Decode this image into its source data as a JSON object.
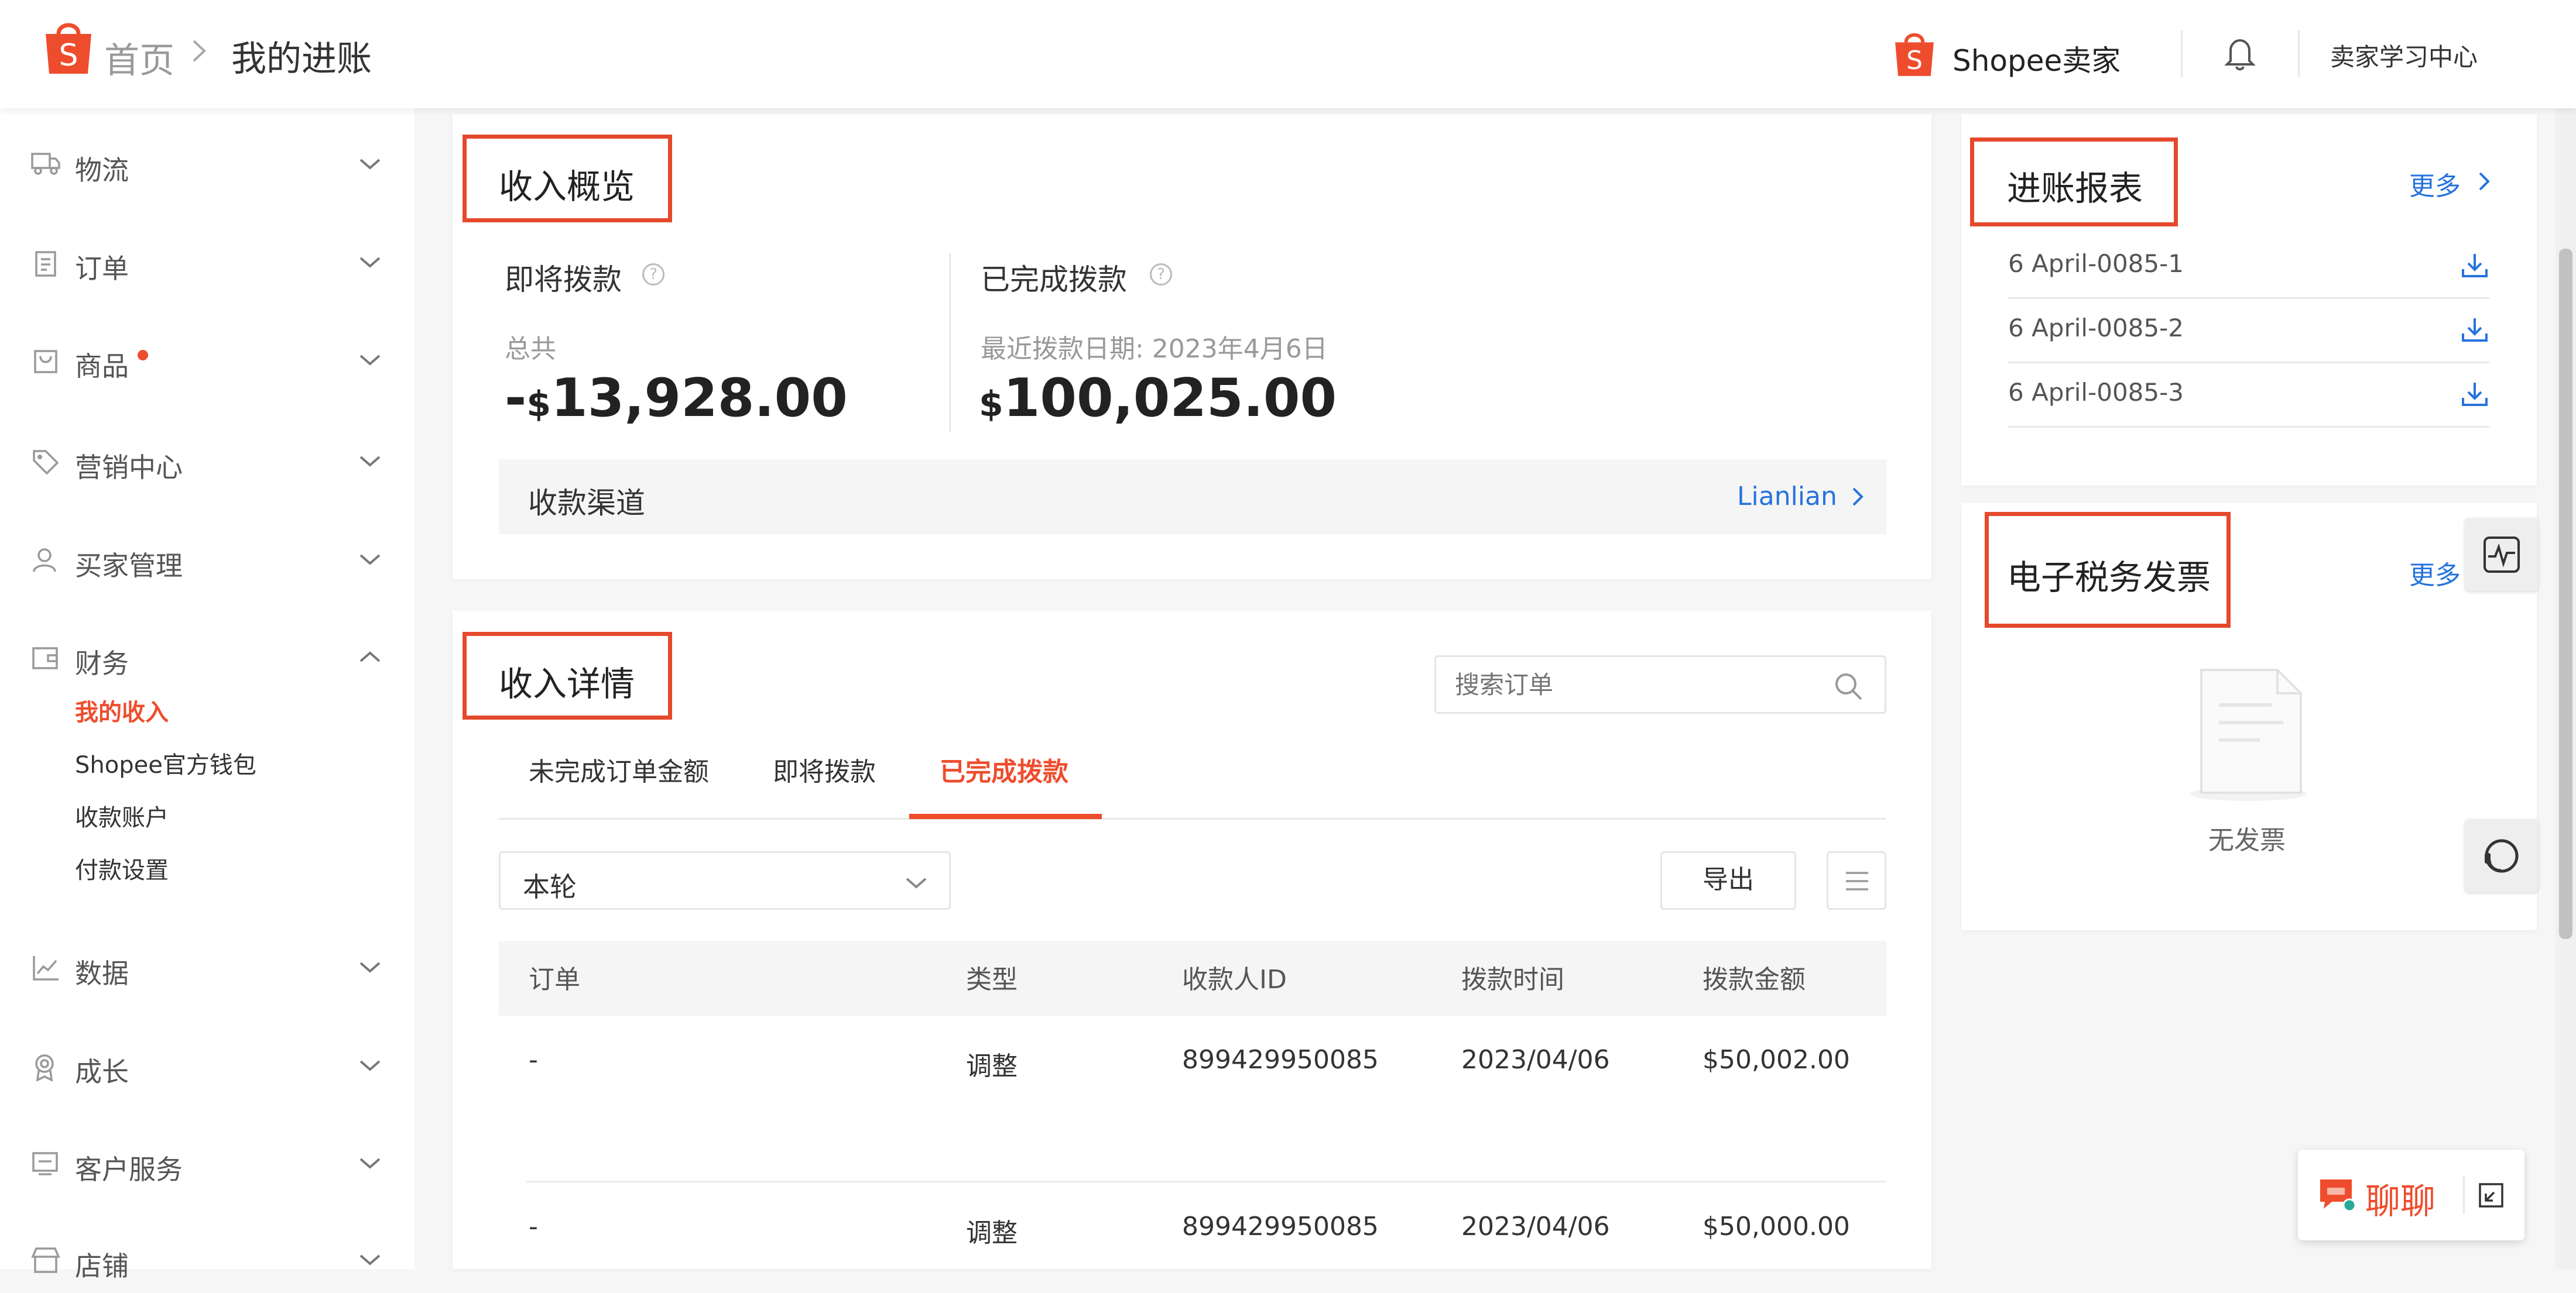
{
  "header": {
    "breadcrumb_home": "首页",
    "breadcrumb_current": "我的进账",
    "seller_label": "Shopee卖家",
    "learning_center": "卖家学习中心"
  },
  "sidebar": {
    "items": [
      {
        "label": "物流",
        "icon": "truck-icon"
      },
      {
        "label": "订单",
        "icon": "clipboard-icon"
      },
      {
        "label": "商品",
        "icon": "bag-icon"
      },
      {
        "label": "营销中心",
        "icon": "tag-icon"
      },
      {
        "label": "买家管理",
        "icon": "user-icon"
      },
      {
        "label": "财务",
        "icon": "wallet-icon"
      },
      {
        "label": "数据",
        "icon": "chart-icon"
      },
      {
        "label": "成长",
        "icon": "badge-icon"
      },
      {
        "label": "客户服务",
        "icon": "headset-icon"
      },
      {
        "label": "店铺",
        "icon": "store-icon"
      }
    ],
    "finance_sub": [
      "我的收入",
      "Shopee官方钱包",
      "收款账户",
      "付款设置"
    ]
  },
  "overview": {
    "title": "收入概览",
    "pending": {
      "label": "即将拨款",
      "sub": "总共",
      "sign": "-",
      "currency": "$",
      "amount": "13,928.00"
    },
    "completed": {
      "label": "已完成拨款",
      "sub": "最近拨款日期:  2023年4月6日",
      "currency": "$",
      "amount": "100,025.00"
    },
    "channel_label": "收款渠道",
    "channel_value": "Lianlian"
  },
  "details": {
    "title": "收入详情",
    "search_placeholder": "搜索订单",
    "tabs": [
      "未完成订单金额",
      "即将拨款",
      "已完成拨款"
    ],
    "period": "本轮",
    "export": "导出",
    "columns": [
      "订单",
      "类型",
      "收款人ID",
      "拨款时间",
      "拨款金额"
    ],
    "rows": [
      [
        "-",
        "调整",
        "899429950085",
        "2023/04/06",
        "$50,002.00"
      ],
      [
        "-",
        "调整",
        "899429950085",
        "2023/04/06",
        "$50,000.00"
      ]
    ]
  },
  "reports": {
    "title": "进账报表",
    "more": "更多",
    "items": [
      "6 April-0085-1",
      "6 April-0085-2",
      "6 April-0085-3"
    ]
  },
  "invoice": {
    "title": "电子税务发票",
    "more": "更多",
    "empty": "无发票"
  },
  "chat": {
    "label": "聊聊"
  },
  "colors": {
    "brand": "#ee4d2d",
    "highlight_box": "#e5492c",
    "link": "#2673dd"
  }
}
